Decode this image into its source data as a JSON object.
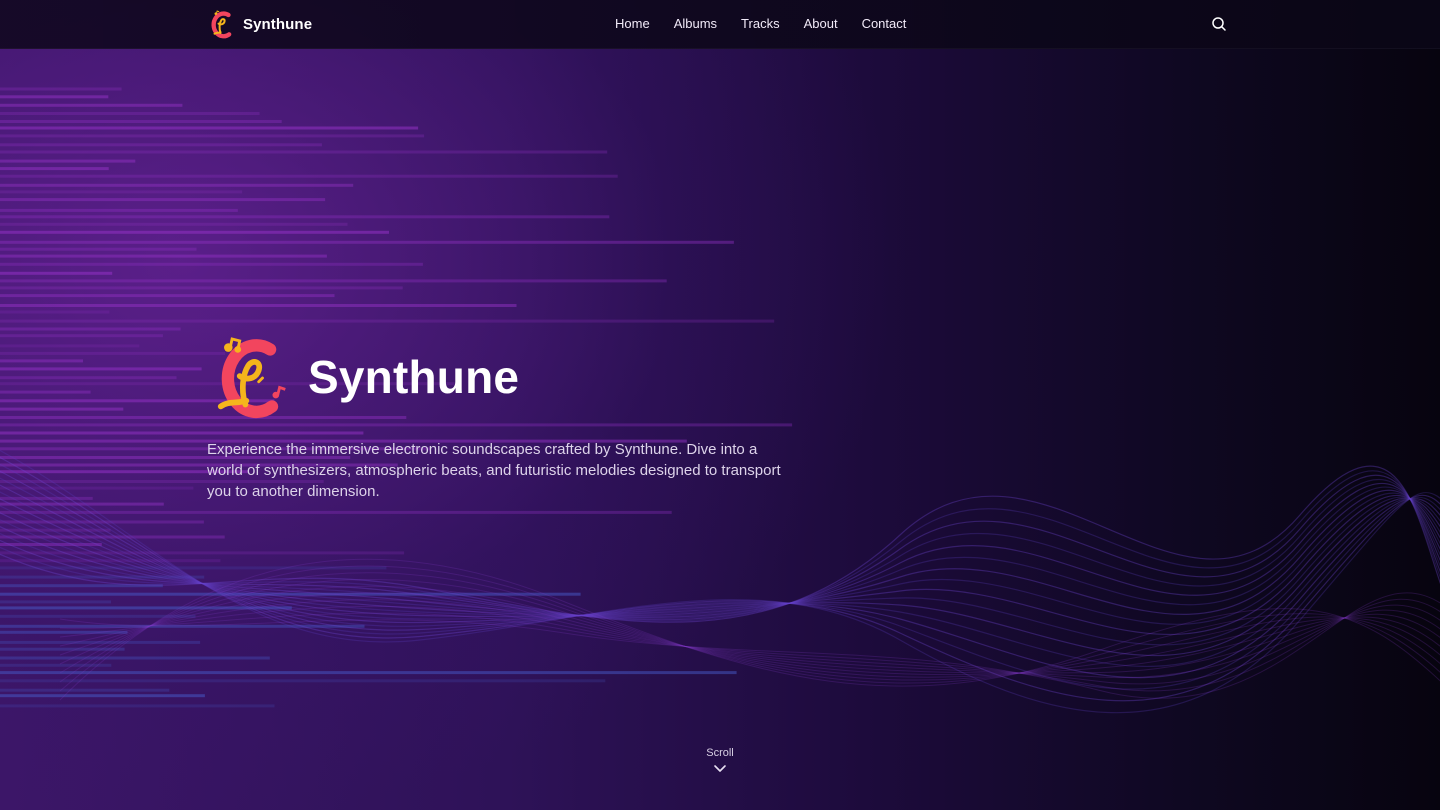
{
  "header": {
    "brand_name": "Synthune",
    "nav": [
      {
        "label": "Home"
      },
      {
        "label": "Albums"
      },
      {
        "label": "Tracks"
      },
      {
        "label": "About"
      },
      {
        "label": "Contact"
      }
    ],
    "search_icon": "search-icon"
  },
  "hero": {
    "title": "Synthune",
    "description": "Experience the immersive electronic soundscapes crafted by Synthune. Dive into a world of synthesizers, atmospheric beats, and futuristic melodies designed to transport you to another dimension.",
    "scroll_label": "Scroll",
    "scroll_icon": "chevron-down-icon"
  },
  "colors": {
    "background_dark": "#0c0618",
    "background_purple": "#3c1668",
    "logo_coral": "#f2455e",
    "logo_gold": "#f5b51c",
    "text_primary": "#ffffff",
    "text_secondary": "#ddd3ea"
  }
}
